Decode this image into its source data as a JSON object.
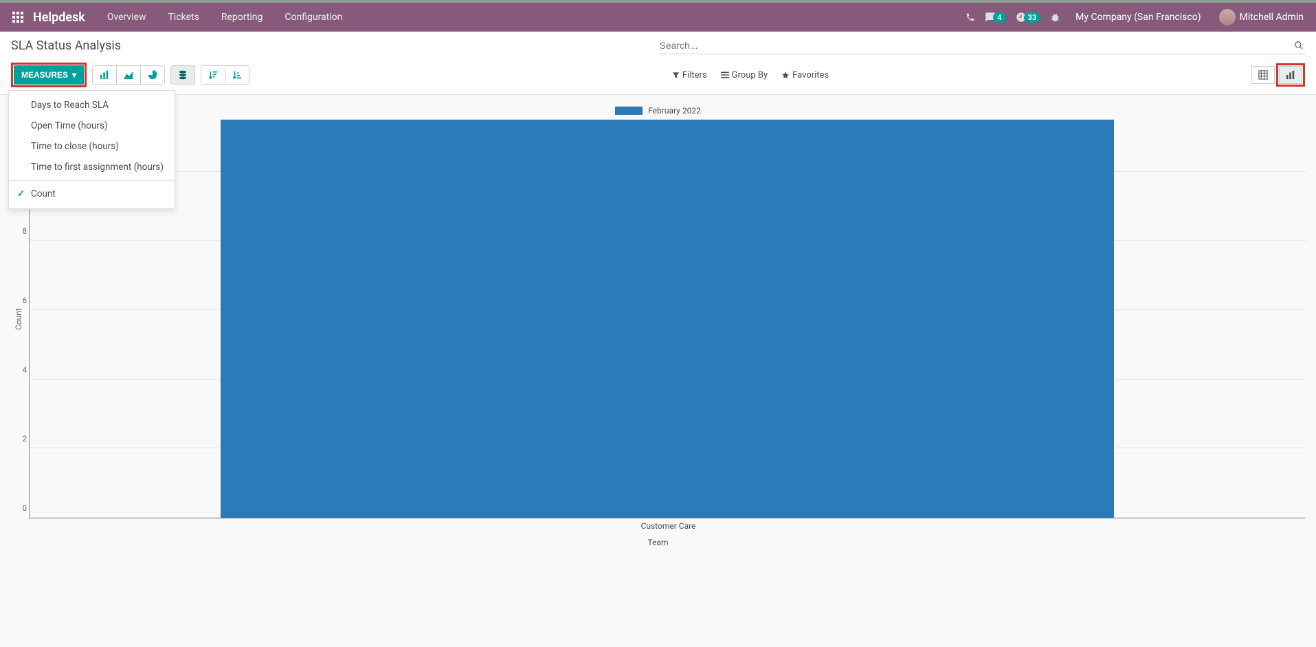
{
  "topbar": {
    "brand": "Helpdesk",
    "nav": [
      "Overview",
      "Tickets",
      "Reporting",
      "Configuration"
    ],
    "messages_badge": "4",
    "activities_badge": "33",
    "company": "My Company (San Francisco)",
    "user": "Mitchell Admin"
  },
  "page_title": "SLA Status Analysis",
  "search": {
    "placeholder": "Search..."
  },
  "toolbar": {
    "measures_label": "Measures",
    "filters_label": "Filters",
    "groupby_label": "Group By",
    "favorites_label": "Favorites"
  },
  "measures_menu": {
    "items": [
      "Days to Reach SLA",
      "Open Time (hours)",
      "Time to close (hours)",
      "Time to first assignment (hours)"
    ],
    "selected": "Count"
  },
  "chart_data": {
    "type": "bar",
    "title": "",
    "legend": [
      "February 2022"
    ],
    "xlabel": "Team",
    "ylabel": "Count",
    "categories": [
      "Customer Care"
    ],
    "series": [
      {
        "name": "February 2022",
        "values": [
          11.5
        ]
      }
    ],
    "yticks": [
      0,
      2,
      4,
      6,
      8,
      10
    ],
    "ylim": [
      0,
      11.5
    ]
  }
}
